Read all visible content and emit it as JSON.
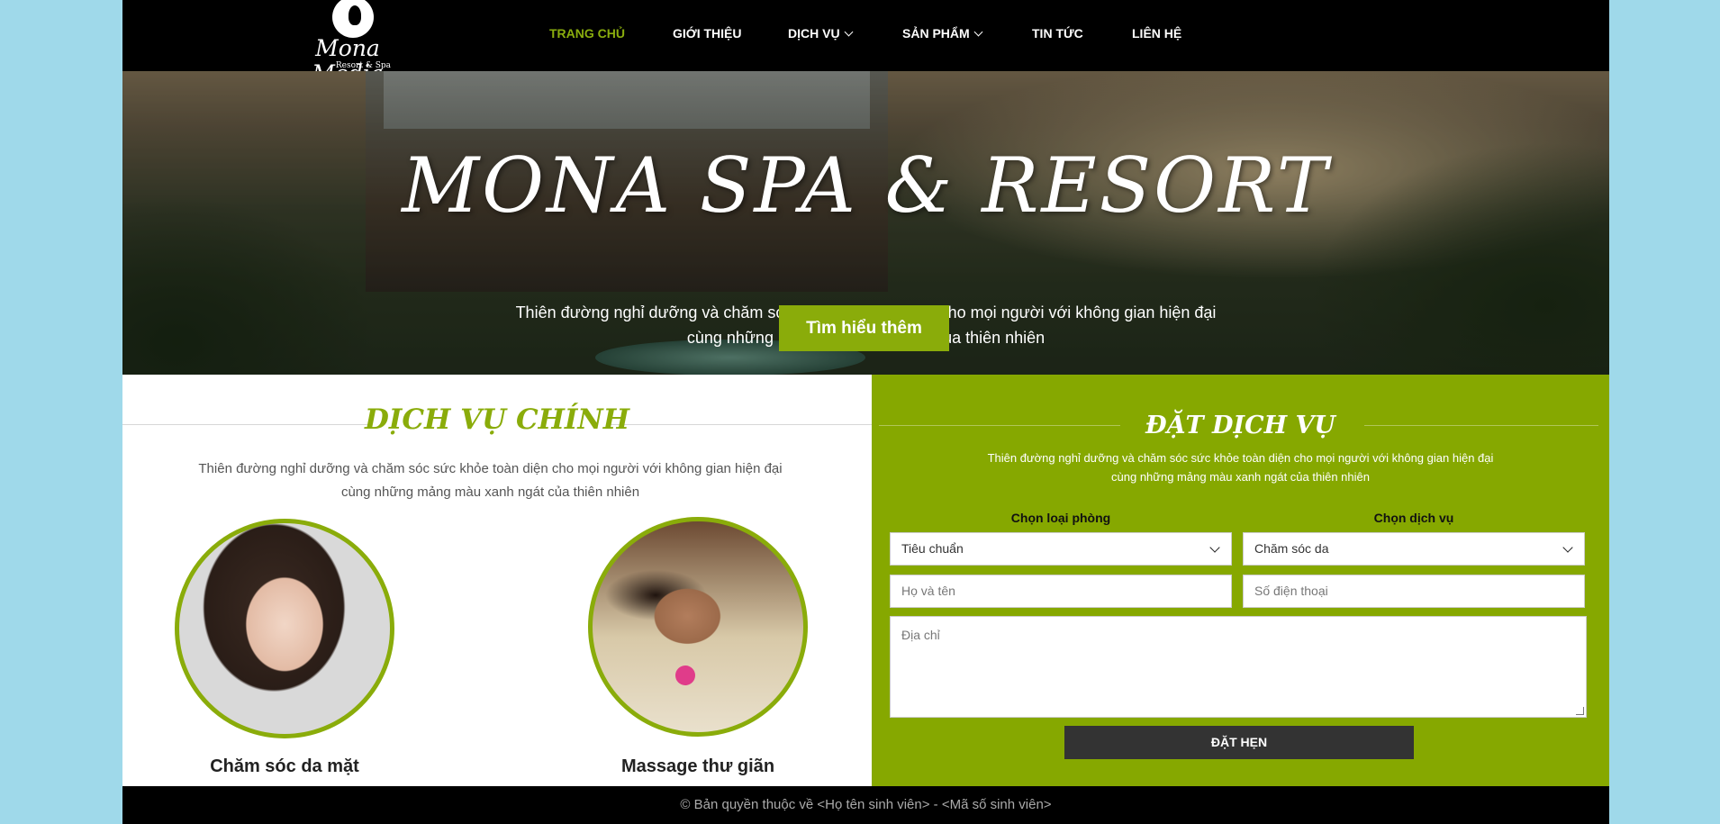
{
  "header": {
    "logo": {
      "name": "Mona Media",
      "tagline": "Resort & Spa"
    },
    "nav": [
      {
        "label": "TRANG CHỦ",
        "active": true,
        "dropdown": false
      },
      {
        "label": "GIỚI THIỆU",
        "active": false,
        "dropdown": false
      },
      {
        "label": "DỊCH VỤ",
        "active": false,
        "dropdown": true
      },
      {
        "label": "SẢN PHẨM",
        "active": false,
        "dropdown": true
      },
      {
        "label": "TIN TỨC",
        "active": false,
        "dropdown": false
      },
      {
        "label": "LIÊN HỆ",
        "active": false,
        "dropdown": false
      }
    ]
  },
  "hero": {
    "title": "MONA SPA & RESORT",
    "subtitle_line1": "Thiên đường nghỉ dưỡng và chăm sóc sức khỏe toàn diện cho mọi người với không gian hiện đại",
    "subtitle_line2": "cùng những mảng màu xanh ngát của thiên nhiên",
    "button": "Tìm hiểu thêm"
  },
  "services": {
    "title": "DỊCH VỤ CHÍNH",
    "desc_line1": "Thiên đường nghỉ dưỡng và chăm sóc sức khỏe toàn diện cho mọi người với không gian hiện đại",
    "desc_line2": "cùng những mảng màu xanh ngát của thiên nhiên",
    "items": [
      {
        "label": "Chăm sóc da mặt"
      },
      {
        "label": "Massage thư giãn"
      }
    ]
  },
  "booking": {
    "title": "ĐẶT DỊCH VỤ",
    "desc_line1": "Thiên đường nghỉ dưỡng và chăm sóc sức khỏe toàn diện cho mọi người với không gian hiện đại",
    "desc_line2": "cùng những mảng màu xanh ngát của thiên nhiên",
    "room_label": "Chọn loại phòng",
    "room_value": "Tiêu chuẩn",
    "service_label": "Chọn dịch vụ",
    "service_value": "Chăm sóc da",
    "name_placeholder": "Họ và tên",
    "phone_placeholder": "Số điện thoại",
    "address_placeholder": "Địa chỉ",
    "submit": "ĐẶT HẸN"
  },
  "footer": {
    "text": "© Bản quyền thuộc về  <Họ tên sinh viên> - <Mã số sinh viên>"
  },
  "colors": {
    "accent": "#8aac0a",
    "booking_bg": "#86a800",
    "header_bg": "#000000",
    "page_bg": "#9fd9ea"
  }
}
